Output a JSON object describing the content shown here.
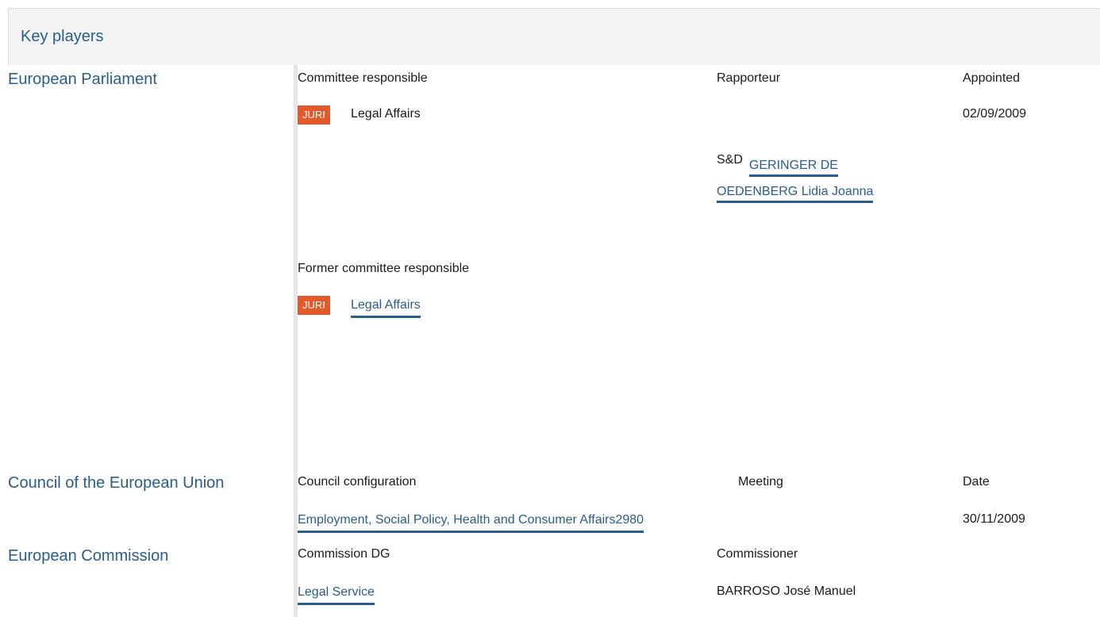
{
  "section": {
    "title": "Key players"
  },
  "parliament": {
    "label": "European Parliament",
    "col_committee": "Committee responsible",
    "col_rapporteur": "Rapporteur",
    "col_appointed": "Appointed",
    "committee_badge": "JURI",
    "committee_name": "Legal Affairs",
    "appointed_date": "02/09/2009",
    "rapporteur_group": "S&D",
    "rapporteur_name_line1": "GERINGER DE",
    "rapporteur_name_line2": "OEDENBERG Lidia Joanna",
    "former_label": "Former committee responsible",
    "former_badge": "JURI",
    "former_name": "Legal Affairs"
  },
  "council": {
    "label": "Council of the European Union",
    "col_config": "Council configuration",
    "col_meeting": "Meeting",
    "col_date": "Date",
    "config_name": "Employment, Social Policy, Health and Consumer Affairs",
    "meeting_number": "2980",
    "date": "30/11/2009"
  },
  "commission": {
    "label": "European Commission",
    "col_dg": "Commission DG",
    "col_commissioner": "Commissioner",
    "dg_name": "Legal Service",
    "commissioner_name": "BARROSO José Manuel"
  },
  "colors": {
    "link": "#2a5d8f",
    "badge": "#e35a2a",
    "header_bg": "#f4f4f4",
    "divider": "#e6e6e6"
  }
}
